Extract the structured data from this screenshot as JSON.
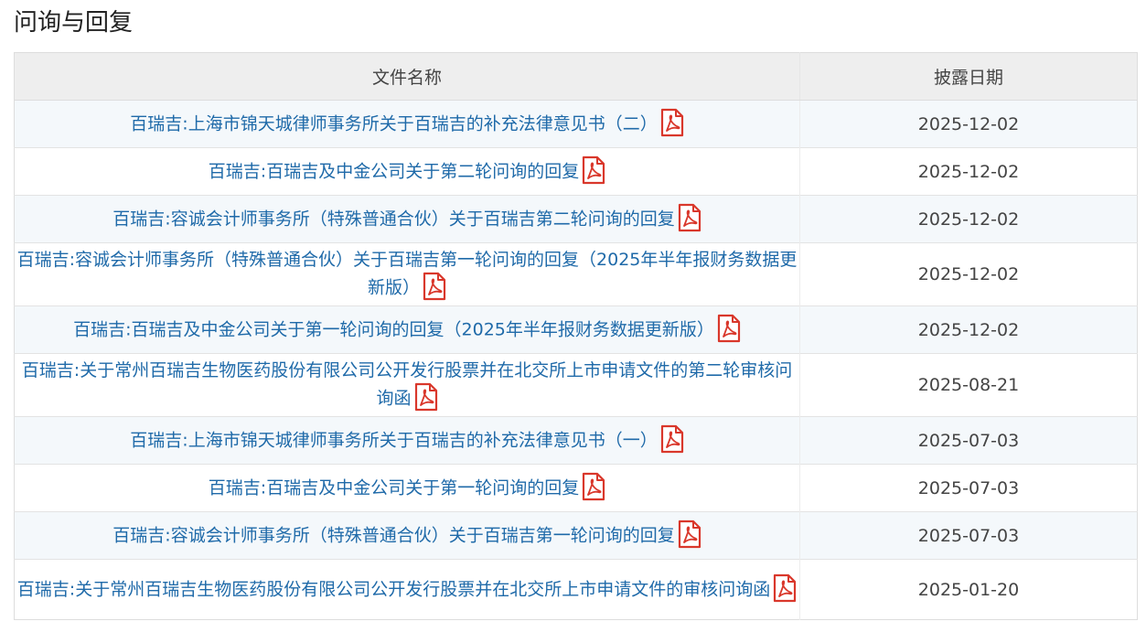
{
  "page": {
    "title": "问询与回复"
  },
  "table": {
    "headers": {
      "name": "文件名称",
      "date": "披露日期"
    },
    "rows": [
      {
        "name": "百瑞吉:上海市锦天城律师事务所关于百瑞吉的补充法律意见书（二）",
        "date": "2025-12-02",
        "file_icon": "pdf-icon"
      },
      {
        "name": "百瑞吉:百瑞吉及中金公司关于第二轮问询的回复",
        "date": "2025-12-02",
        "file_icon": "pdf-icon"
      },
      {
        "name": "百瑞吉:容诚会计师事务所（特殊普通合伙）关于百瑞吉第二轮问询的回复",
        "date": "2025-12-02",
        "file_icon": "pdf-icon"
      },
      {
        "name": "百瑞吉:容诚会计师事务所（特殊普通合伙）关于百瑞吉第一轮问询的回复（2025年半年报财务数据更新版）",
        "date": "2025-12-02",
        "file_icon": "pdf-icon"
      },
      {
        "name": "百瑞吉:百瑞吉及中金公司关于第一轮问询的回复（2025年半年报财务数据更新版）",
        "date": "2025-12-02",
        "file_icon": "pdf-icon"
      },
      {
        "name": "百瑞吉:关于常州百瑞吉生物医药股份有限公司公开发行股票并在北交所上市申请文件的第二轮审核问询函",
        "date": "2025-08-21",
        "file_icon": "pdf-icon"
      },
      {
        "name": "百瑞吉:上海市锦天城律师事务所关于百瑞吉的补充法律意见书（一）",
        "date": "2025-07-03",
        "file_icon": "pdf-icon"
      },
      {
        "name": "百瑞吉:百瑞吉及中金公司关于第一轮问询的回复",
        "date": "2025-07-03",
        "file_icon": "pdf-icon"
      },
      {
        "name": "百瑞吉:容诚会计师事务所（特殊普通合伙）关于百瑞吉第一轮问询的回复",
        "date": "2025-07-03",
        "file_icon": "pdf-icon"
      },
      {
        "name": "百瑞吉:关于常州百瑞吉生物医药股份有限公司公开发行股票并在北交所上市申请文件的审核问询函",
        "date": "2025-01-20",
        "file_icon": "pdf-icon"
      }
    ]
  },
  "colors": {
    "link": "#1f6aa9",
    "header_bg": "#eeeeee",
    "stripe_bg": "#f4f8fb",
    "pdf_red": "#d9372b",
    "text": "#444444"
  }
}
